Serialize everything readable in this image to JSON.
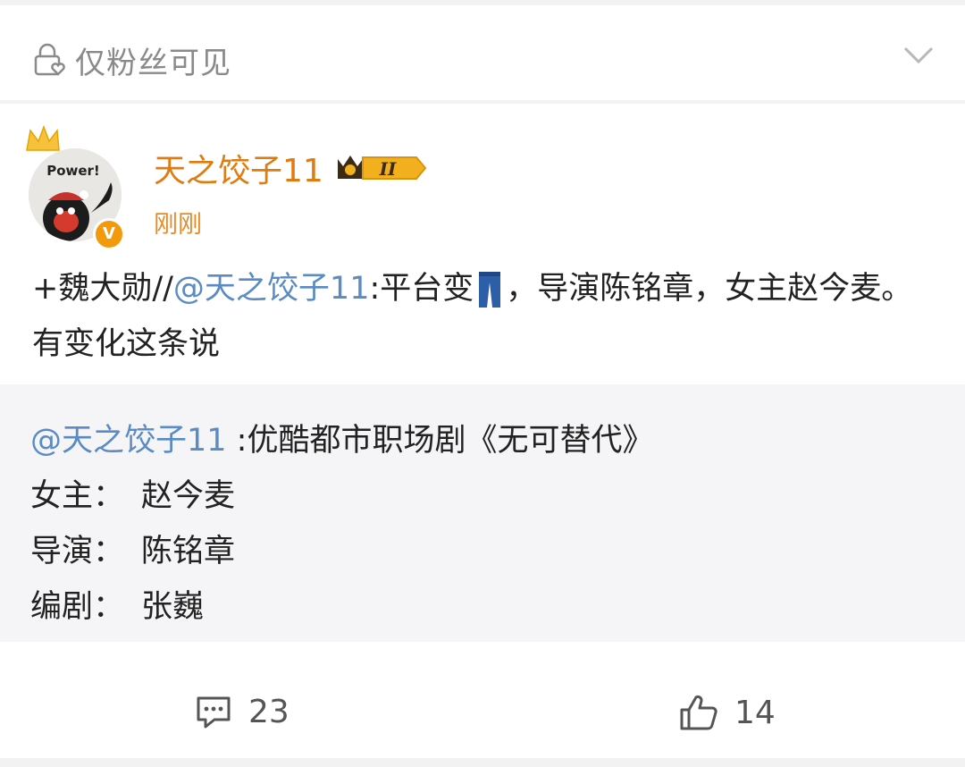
{
  "visibility": {
    "label": "仅粉丝可见",
    "icon": "lock-heart-icon"
  },
  "post": {
    "author": "天之饺子11",
    "time": "刚刚",
    "badge_text": "II",
    "avatar_text": "Power!",
    "verified_mark": "V",
    "text_prefix": "+魏大勋//",
    "mention": "@天之饺子11",
    "text_a": ":平台变",
    "text_b": "，导演陈铭章，女主赵今麦。有变化这条说"
  },
  "quote": {
    "mention": "@天之饺子11",
    "line1_rest": " :优酷都市职场剧《无可替代》",
    "rows": [
      {
        "label": "女主：",
        "value": "赵今麦"
      },
      {
        "label": "导演：",
        "value": "陈铭章"
      },
      {
        "label": "编剧：",
        "value": "张巍"
      }
    ]
  },
  "actions": {
    "comments": "23",
    "likes": "14"
  },
  "colors": {
    "author": "#e07b0f",
    "mention": "#5b8bc4",
    "badge": "#f2b01e"
  }
}
